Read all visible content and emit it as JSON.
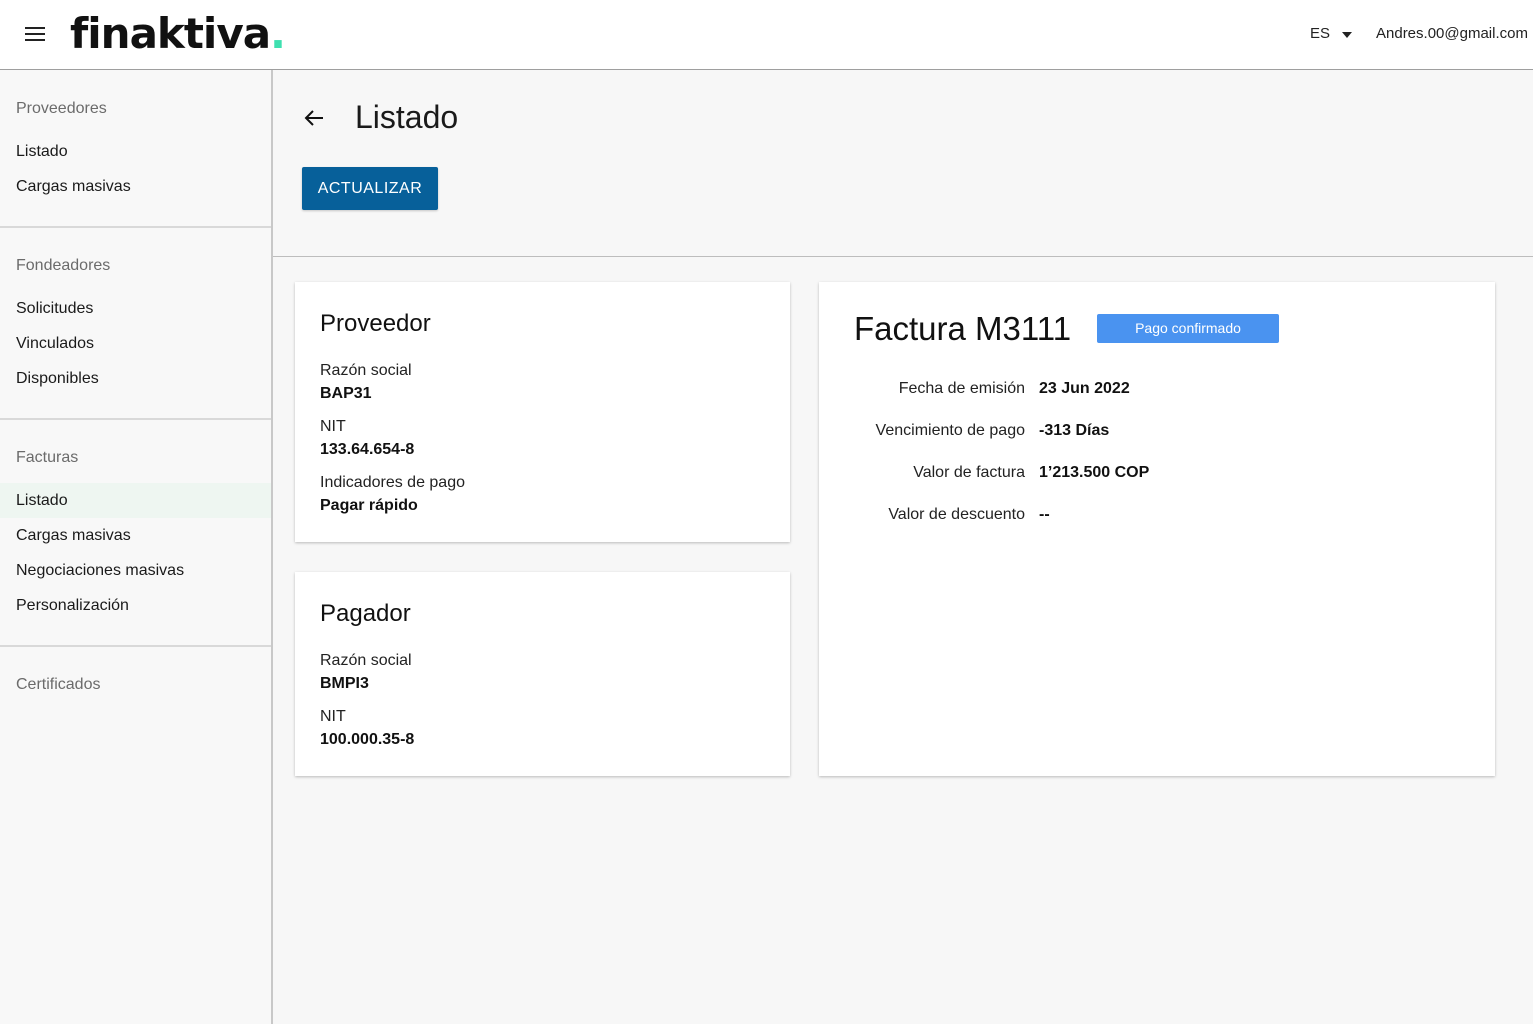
{
  "header": {
    "logo_text": "finaktiva",
    "logo_dot": ".",
    "language": "ES",
    "user_email": "Andres.00@gmail.com",
    "accent_color": "#3fe0b0"
  },
  "sidebar": {
    "sections": [
      {
        "heading": "Proveedores",
        "items": [
          "Listado",
          "Cargas masivas"
        ]
      },
      {
        "heading": "Fondeadores",
        "items": [
          "Solicitudes",
          "Vinculados",
          "Disponibles"
        ]
      },
      {
        "heading": "Facturas",
        "items": [
          "Listado",
          "Cargas masivas",
          "Negociaciones masivas",
          "Personalización"
        ],
        "active_item": "Listado"
      },
      {
        "heading": "Certificados",
        "items": []
      }
    ]
  },
  "page": {
    "title": "Listado",
    "update_button": "ACTUALIZAR",
    "primary_color": "#07609a"
  },
  "proveedor": {
    "title": "Proveedor",
    "razon_social_label": "Razón social",
    "razon_social": "BAP31",
    "nit_label": "NIT",
    "nit": "133.64.654-8",
    "indicadores_label": "Indicadores de pago",
    "indicadores": "Pagar rápido"
  },
  "pagador": {
    "title": "Pagador",
    "razon_social_label": "Razón social",
    "razon_social": "BMPI3",
    "nit_label": "NIT",
    "nit": "100.000.35-8"
  },
  "factura": {
    "title": "Factura M3111",
    "status": "Pago confirmado",
    "status_color": "#4a93f0",
    "fields": [
      {
        "label": "Fecha de emisión",
        "value": "23 Jun 2022"
      },
      {
        "label": "Vencimiento de pago",
        "value": "-313 Días"
      },
      {
        "label": "Valor de factura",
        "value": "1’213.500 COP"
      },
      {
        "label": "Valor de descuento",
        "value": "--"
      }
    ]
  }
}
